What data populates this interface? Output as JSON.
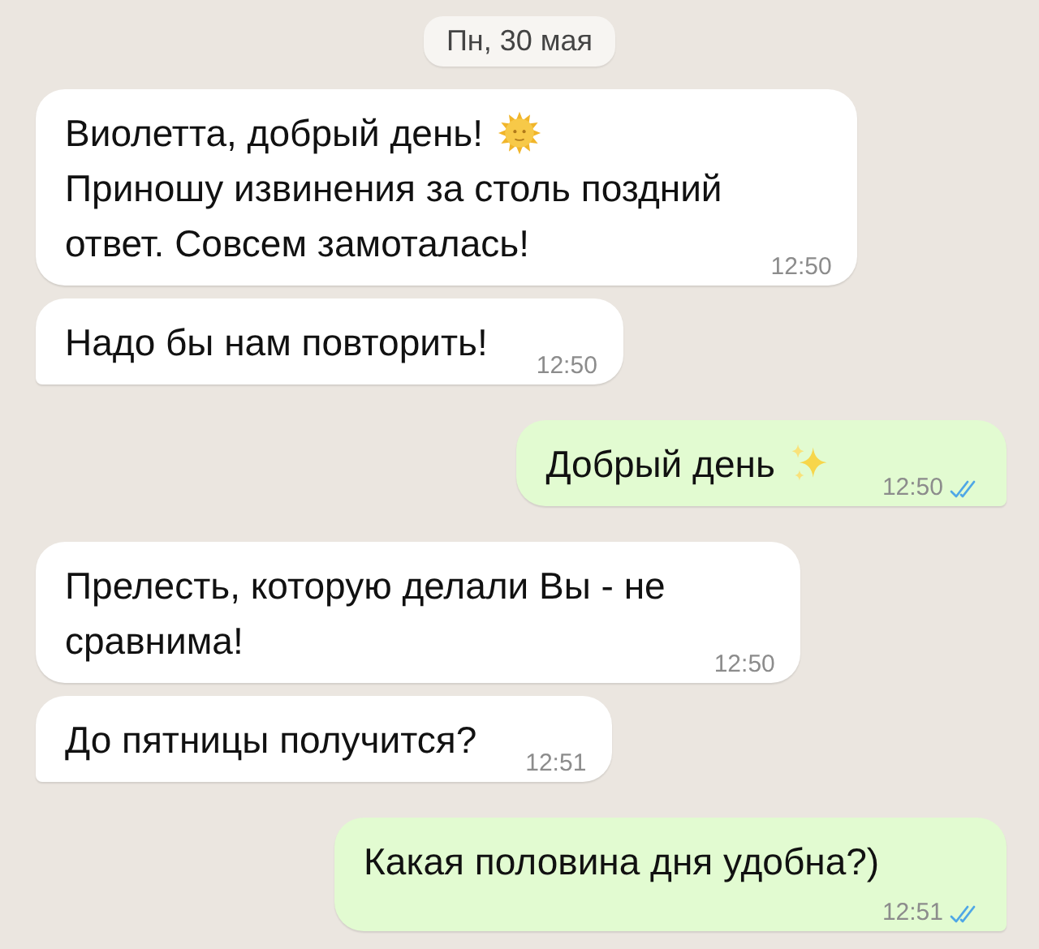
{
  "date_divider": "Пн, 30 мая",
  "messages": [
    {
      "outgoing": false,
      "tail": false,
      "paragraphs": [
        {
          "kind": "sun",
          "lines": [
            "Виолетта, добрый день!"
          ]
        },
        {
          "kind": "plain",
          "lines": [
            "Приношу извинения за столь поздний",
            "ответ. Совсем замоталась!"
          ]
        }
      ],
      "time": "12:50"
    },
    {
      "outgoing": false,
      "tail": true,
      "paragraphs": [
        {
          "kind": "plain",
          "lines": [
            "Надо бы нам повторить!"
          ]
        }
      ],
      "time": "12:50"
    },
    {
      "outgoing": true,
      "tail": true,
      "paragraphs": [
        {
          "kind": "sparkles",
          "lines": [
            "Добрый день"
          ]
        }
      ],
      "time": "12:50",
      "read": true
    },
    {
      "outgoing": false,
      "tail": false,
      "paragraphs": [
        {
          "kind": "plain",
          "lines": [
            "Прелесть, которую делали Вы - не",
            "сравнима!"
          ]
        }
      ],
      "time": "12:50"
    },
    {
      "outgoing": false,
      "tail": true,
      "paragraphs": [
        {
          "kind": "plain",
          "lines": [
            "До пятницы получится?"
          ]
        }
      ],
      "time": "12:51"
    },
    {
      "outgoing": true,
      "tail": true,
      "paragraphs": [
        {
          "kind": "plain",
          "lines": [
            "Какая половина дня удобна?)"
          ]
        }
      ],
      "time": "12:51",
      "read": true
    }
  ]
}
